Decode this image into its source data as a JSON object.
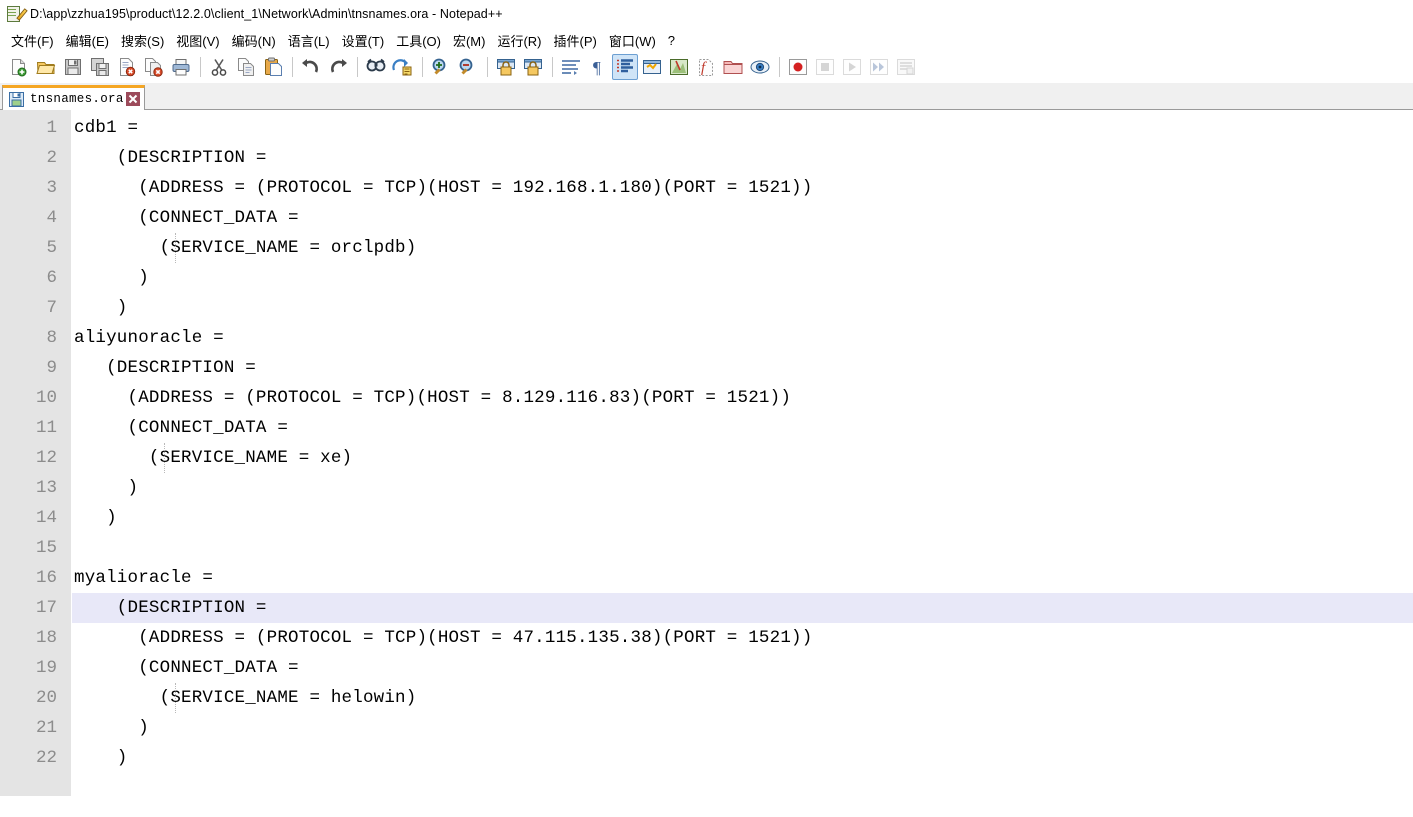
{
  "window": {
    "title": "D:\\app\\zzhua195\\product\\12.2.0\\client_1\\Network\\Admin\\tnsnames.ora - Notepad++",
    "app_icon": "notepad-plus-plus-icon"
  },
  "menu": {
    "items": [
      {
        "label": "文件(F)",
        "name": "menu-file"
      },
      {
        "label": "编辑(E)",
        "name": "menu-edit"
      },
      {
        "label": "搜索(S)",
        "name": "menu-search"
      },
      {
        "label": "视图(V)",
        "name": "menu-view"
      },
      {
        "label": "编码(N)",
        "name": "menu-encoding"
      },
      {
        "label": "语言(L)",
        "name": "menu-language"
      },
      {
        "label": "设置(T)",
        "name": "menu-settings"
      },
      {
        "label": "工具(O)",
        "name": "menu-tools"
      },
      {
        "label": "宏(M)",
        "name": "menu-macro"
      },
      {
        "label": "运行(R)",
        "name": "menu-run"
      },
      {
        "label": "插件(P)",
        "name": "menu-plugins"
      },
      {
        "label": "窗口(W)",
        "name": "menu-window"
      },
      {
        "label": "?",
        "name": "menu-help"
      }
    ]
  },
  "toolbar": {
    "buttons": [
      {
        "name": "new-file-icon",
        "group": 0
      },
      {
        "name": "open-file-icon",
        "group": 0
      },
      {
        "name": "save-icon",
        "group": 0
      },
      {
        "name": "save-all-icon",
        "group": 0
      },
      {
        "name": "close-file-icon",
        "group": 0
      },
      {
        "name": "close-all-files-icon",
        "group": 0
      },
      {
        "name": "print-icon",
        "group": 0
      },
      {
        "name": "cut-icon",
        "group": 1
      },
      {
        "name": "copy-icon",
        "group": 1
      },
      {
        "name": "paste-icon",
        "group": 1
      },
      {
        "name": "undo-icon",
        "group": 2
      },
      {
        "name": "redo-icon",
        "group": 2
      },
      {
        "name": "find-icon",
        "group": 3
      },
      {
        "name": "replace-icon",
        "group": 3
      },
      {
        "name": "zoom-in-icon",
        "group": 4
      },
      {
        "name": "zoom-out-icon",
        "group": 4
      },
      {
        "name": "sync-vertical-scroll-icon",
        "group": 5
      },
      {
        "name": "sync-horizontal-scroll-icon",
        "group": 5
      },
      {
        "name": "word-wrap-icon",
        "group": 6
      },
      {
        "name": "show-paragraph-marks-icon",
        "group": 6
      },
      {
        "name": "show-all-characters-icon",
        "group": 6,
        "active": true
      },
      {
        "name": "indent-guide-icon",
        "group": 6
      },
      {
        "name": "show-ui-map-icon",
        "group": 6
      },
      {
        "name": "function-list-icon",
        "group": 6
      },
      {
        "name": "folder-as-workspace-icon",
        "group": 6
      },
      {
        "name": "document-map-icon",
        "group": 6
      },
      {
        "name": "record-macro-icon",
        "group": 7
      },
      {
        "name": "stop-recording-icon",
        "group": 7,
        "disabled": true
      },
      {
        "name": "play-macro-icon",
        "group": 7,
        "disabled": true
      },
      {
        "name": "run-macro-multiple-icon",
        "group": 7,
        "disabled": true
      },
      {
        "name": "save-macro-icon",
        "group": 7,
        "disabled": true
      }
    ]
  },
  "tabs": [
    {
      "label": "tnsnames.ora",
      "icon": "saved-file-icon",
      "close_label": "✕",
      "active": true
    }
  ],
  "editor": {
    "current_line": 17,
    "lines": [
      {
        "n": 1,
        "text": "cdb1 ="
      },
      {
        "n": 2,
        "text": "    (DESCRIPTION ="
      },
      {
        "n": 3,
        "text": "      (ADDRESS = (PROTOCOL = TCP)(HOST = 192.168.1.180)(PORT = 1521))"
      },
      {
        "n": 4,
        "text": "      (CONNECT_DATA ="
      },
      {
        "n": 5,
        "text": "        (SERVICE_NAME = orclpdb)"
      },
      {
        "n": 6,
        "text": "      )"
      },
      {
        "n": 7,
        "text": "    )"
      },
      {
        "n": 8,
        "text": "aliyunoracle ="
      },
      {
        "n": 9,
        "text": "   (DESCRIPTION ="
      },
      {
        "n": 10,
        "text": "     (ADDRESS = (PROTOCOL = TCP)(HOST = 8.129.116.83)(PORT = 1521))"
      },
      {
        "n": 11,
        "text": "     (CONNECT_DATA ="
      },
      {
        "n": 12,
        "text": "       (SERVICE_NAME = xe)"
      },
      {
        "n": 13,
        "text": "     )"
      },
      {
        "n": 14,
        "text": "   )"
      },
      {
        "n": 15,
        "text": ""
      },
      {
        "n": 16,
        "text": "myalioracle ="
      },
      {
        "n": 17,
        "text": "    (DESCRIPTION ="
      },
      {
        "n": 18,
        "text": "      (ADDRESS = (PROTOCOL = TCP)(HOST = 47.115.135.38)(PORT = 1521))"
      },
      {
        "n": 19,
        "text": "      (CONNECT_DATA ="
      },
      {
        "n": 20,
        "text": "        (SERVICE_NAME = helowin)"
      },
      {
        "n": 21,
        "text": "      )"
      },
      {
        "n": 22,
        "text": "    )"
      }
    ]
  },
  "colors": {
    "gutter_bg": "#e4e4e4",
    "gutter_fg": "#8c8c8c",
    "current_line_bg": "#e8e8f8",
    "tab_active_top": "#f5a623",
    "tab_close_bg": "#9c4a5a",
    "toolbar_active_bg": "#cfe4f7",
    "text_fg": "#000000"
  }
}
